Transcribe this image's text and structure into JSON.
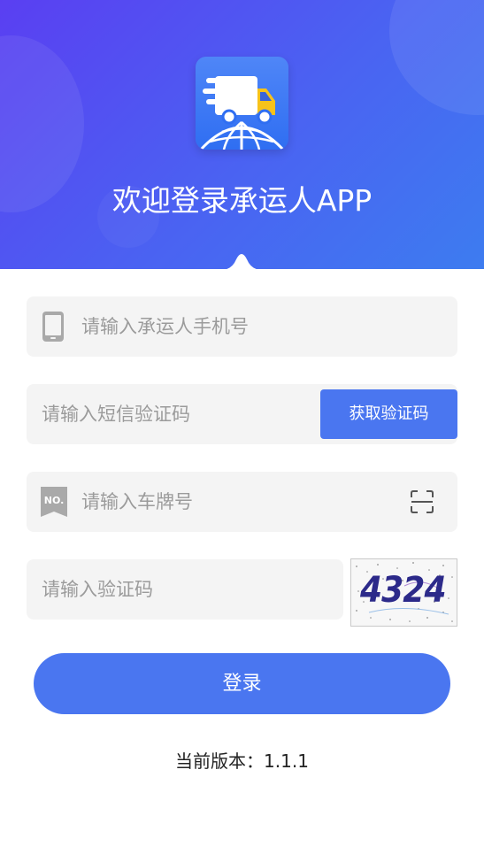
{
  "header": {
    "title": "欢迎登录承运人APP",
    "gradient_start": "#5a3ff2",
    "gradient_end": "#3d7cf0",
    "logo_icon": "truck-globe-logo"
  },
  "form": {
    "phone": {
      "placeholder": "请输入承运人手机号",
      "icon": "phone-icon"
    },
    "sms": {
      "placeholder": "请输入短信验证码",
      "button_label": "获取验证码"
    },
    "plate": {
      "placeholder": "请输入车牌号",
      "icon": "license-plate-icon",
      "scan_icon": "scan-icon",
      "badge_text": "NO."
    },
    "captcha": {
      "placeholder": "请输入验证码",
      "image_text": "4324"
    }
  },
  "login_label": "登录",
  "version": {
    "label": "当前版本：",
    "value": "1.1.1"
  },
  "colors": {
    "accent": "#4a76f0",
    "field_bg": "#f4f4f4",
    "placeholder": "#9b9b9b"
  }
}
